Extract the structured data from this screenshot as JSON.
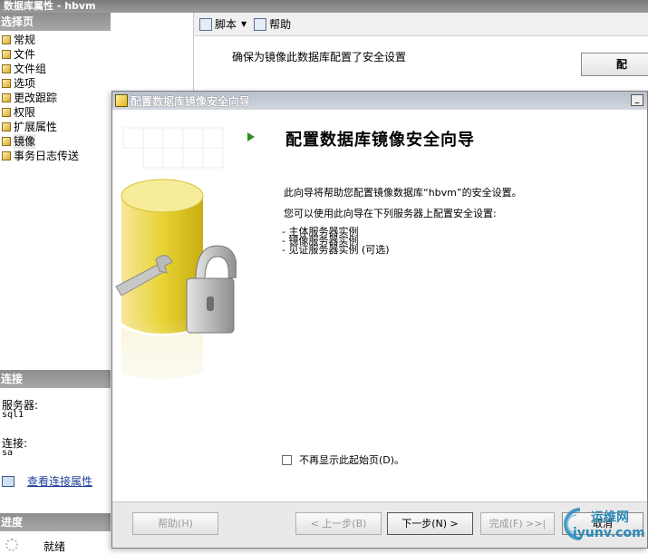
{
  "main_window": {
    "title": "数据库属性 - hbvm",
    "select_page_header": "选择页",
    "nav_items": [
      {
        "label": "常规"
      },
      {
        "label": "文件"
      },
      {
        "label": "文件组"
      },
      {
        "label": "选项"
      },
      {
        "label": "更改跟踪"
      },
      {
        "label": "权限"
      },
      {
        "label": "扩展属性"
      },
      {
        "label": "镜像",
        "selected": true
      },
      {
        "label": "事务日志传送"
      }
    ],
    "connection": {
      "header": "连接",
      "server_label": "服务器:",
      "server_value": "sql1",
      "conn_label": "连接:",
      "conn_value": "sa",
      "view_link": "查看连接属性"
    },
    "progress": {
      "header": "进度",
      "status": "就绪"
    },
    "toolbar": {
      "script_label": "脚本",
      "help_label": "帮助"
    },
    "status_message": "确保为镜像此数据库配置了安全设置",
    "corner_button_fragment": "配"
  },
  "wizard": {
    "title": "配置数据库镜像安全向导",
    "minimize_glyph": "_",
    "heading": "配置数据库镜像安全向导",
    "intro": "此向导将帮助您配置镜像数据库“hbvm”的安全设置。",
    "sub_intro": "您可以使用此向导在下列服务器上配置安全设置:",
    "bullets": [
      "- 主体服务器实例",
      "- 镜像服务器实例",
      "- 见证服务器实例 (可选)"
    ],
    "checkbox_label": "不再显示此起始页(D)。",
    "checkbox_checked": false,
    "buttons": {
      "help": "帮助(H)",
      "back": "< 上一步(B)",
      "next": "下一步(N) >",
      "finish": "完成(F) >>|",
      "cancel": "取消"
    }
  },
  "watermark": {
    "top": "运维网",
    "bottom": "iyunv.com"
  },
  "colors": {
    "section_header": "#9a9a9a",
    "wizard_title_bar": "#c3c9d2",
    "link": "#1d3f9b",
    "arrow": "#2f8a22",
    "watermark": "#2a8ab8"
  }
}
